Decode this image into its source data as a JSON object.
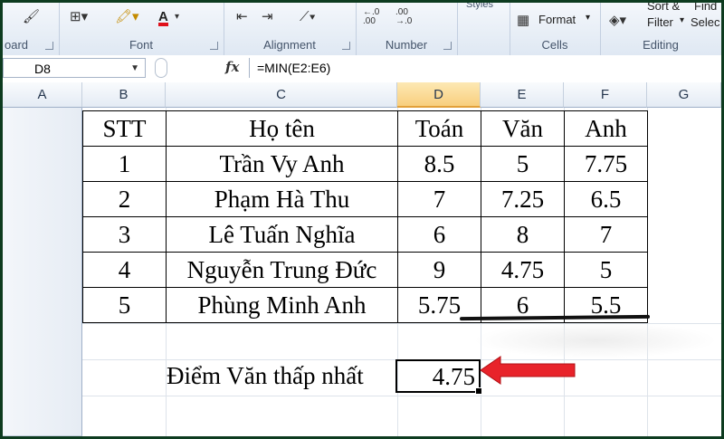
{
  "ribbon": {
    "clipboard_label": "oard",
    "font_label": "Font",
    "alignment_label": "Alignment",
    "number_label": "Number",
    "styles_label": "Styles",
    "cells_label": "Cells",
    "format_label": "Format",
    "editing_label": "Editing",
    "sort_label": "Sort &",
    "filter_label": "Filter",
    "find_label": "Find",
    "select_label": "Selec",
    "number_inc": "←.0 .00",
    "number_dec": ".00 →.0"
  },
  "formula_bar": {
    "name_box": "D8",
    "fx": "fx",
    "formula": "=MIN(E2:E6)"
  },
  "columns": [
    "A",
    "B",
    "C",
    "D",
    "E",
    "F",
    "G"
  ],
  "table": {
    "header": [
      "STT",
      "Họ tên",
      "Toán",
      "Văn",
      "Anh"
    ],
    "rows": [
      [
        "1",
        "Trần Vy Anh",
        "8.5",
        "5",
        "7.75"
      ],
      [
        "2",
        "Phạm Hà Thu",
        "7",
        "7.25",
        "6.5"
      ],
      [
        "3",
        "Lê Tuấn Nghĩa",
        "6",
        "8",
        "7"
      ],
      [
        "4",
        "Nguyễn Trung Đức",
        "9",
        "4.75",
        "5"
      ],
      [
        "5",
        "Phùng Minh Anh",
        "5.75",
        "6",
        "5.5"
      ]
    ]
  },
  "summary": {
    "label": "Điểm Văn thấp nhất",
    "value": "4.75"
  },
  "colors": {
    "arrow": "#e8232a",
    "selected_header": "#f8cf7e"
  }
}
